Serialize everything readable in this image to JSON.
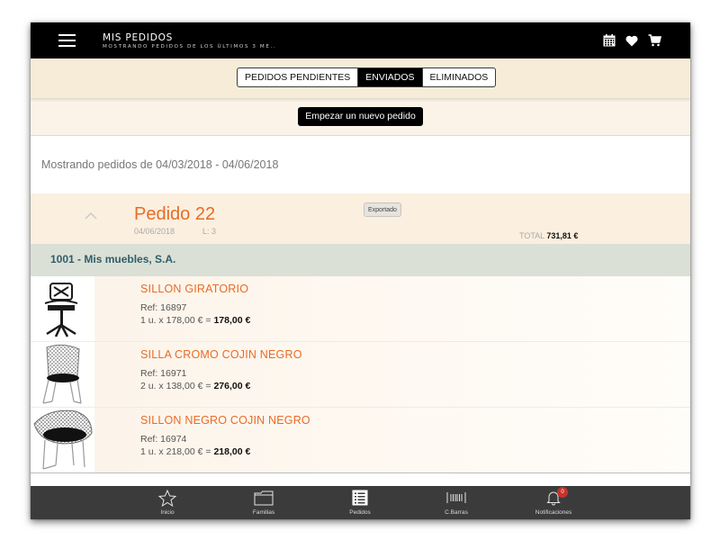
{
  "header": {
    "title": "MIS PEDIDOS",
    "subtitle": "MOSTRANDO PEDIDOS DE LOS ÚLTIMOS 3 ME..",
    "icons": [
      "menu-icon",
      "calendar-icon",
      "heart-icon",
      "cart-icon"
    ]
  },
  "tabs": [
    {
      "label": "PEDIDOS PENDIENTES",
      "active": false
    },
    {
      "label": "ENVIADOS",
      "active": true
    },
    {
      "label": "ELIMINADOS",
      "active": false
    }
  ],
  "new_order_button": "Empezar un nuevo pedido",
  "date_range": "Mostrando pedidos de 04/03/2018 - 04/06/2018",
  "order": {
    "title": "Pedido 22",
    "date": "04/06/2018",
    "lines": "L: 3",
    "status_badge": "Exportado",
    "total_label": "TOTAL",
    "total_value": "731,81 €",
    "company": "1001 - Mis muebles, S.A."
  },
  "items": [
    {
      "name": "SILLON GIRATORIO",
      "ref": "Ref: 16897",
      "qty_price": "1 u. x 178,00 € = ",
      "line_total": "178,00 €",
      "image": "swivel-chair-image"
    },
    {
      "name": "SILLA CROMO COJIN NEGRO",
      "ref": "Ref: 16971",
      "qty_price": "2 u. x 138,00 € = ",
      "line_total": "276,00 €",
      "image": "wire-chair-image"
    },
    {
      "name": "SILLON NEGRO COJIN NEGRO",
      "ref": "Ref: 16974",
      "qty_price": "1 u. x 218,00 € = ",
      "line_total": "218,00 €",
      "image": "wire-armchair-image"
    }
  ],
  "bottom_nav": [
    {
      "label": "Inicio",
      "icon": "star-icon"
    },
    {
      "label": "Familias",
      "icon": "folder-icon"
    },
    {
      "label": "Pedidos",
      "icon": "list-icon"
    },
    {
      "label": "C.Barras",
      "icon": "barcode-icon"
    },
    {
      "label": "Notificaciones",
      "icon": "bell-icon",
      "badge": "0"
    }
  ],
  "colors": {
    "accent": "#e96b26",
    "topbar": "#000000",
    "tabs_bg": "#f7ecd8",
    "company_bg": "#dbe0d6",
    "company_text": "#2f5e69",
    "bottom_nav": "#3b3b3b",
    "badge": "#c8322c"
  }
}
